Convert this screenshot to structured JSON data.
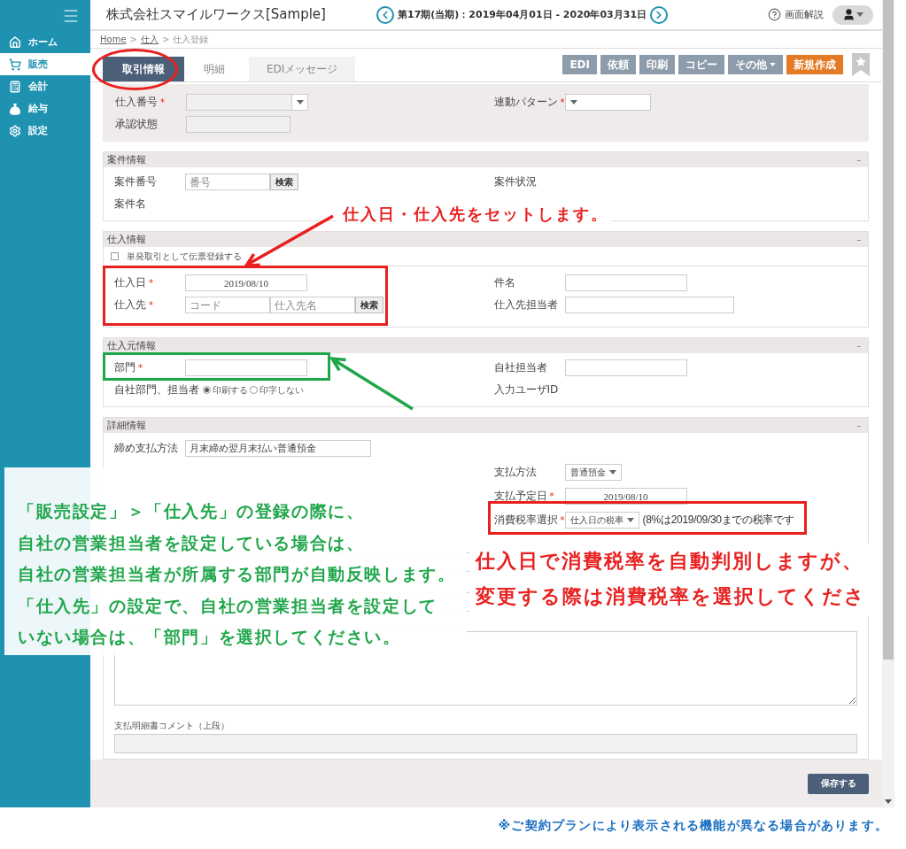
{
  "sidebar": {
    "items": [
      {
        "label": "ホーム",
        "selected": false
      },
      {
        "label": "販売",
        "selected": true
      },
      {
        "label": "会計",
        "selected": false
      },
      {
        "label": "給与",
        "selected": false
      },
      {
        "label": "設定",
        "selected": false
      }
    ]
  },
  "header": {
    "title": "株式会社スマイルワークス[Sample]",
    "period": "第17期(当期)：2019年04月01日 - 2020年03月31日",
    "help": "画面解説"
  },
  "breadcrumb": {
    "separator": ">",
    "items": [
      {
        "label": "Home",
        "link": true
      },
      {
        "label": "仕入",
        "link": true
      },
      {
        "label": "仕入登録",
        "link": false
      }
    ]
  },
  "tabs": [
    {
      "label": "取引情報",
      "selected": true
    },
    {
      "label": "明細",
      "selected": false
    },
    {
      "label": "EDIメッセージ",
      "selected": false
    }
  ],
  "actions": [
    {
      "label": "EDI",
      "disabled": true,
      "dropdown": false
    },
    {
      "label": "依頼",
      "disabled": true,
      "dropdown": false
    },
    {
      "label": "印刷",
      "disabled": true,
      "dropdown": false
    },
    {
      "label": "コピー",
      "disabled": true,
      "dropdown": false
    },
    {
      "label": "その他",
      "disabled": true,
      "dropdown": true
    },
    {
      "label": "新規作成",
      "disabled": false,
      "dropdown": false
    }
  ],
  "top_form": {
    "rows": [
      {
        "kind": "pair",
        "left": {
          "label": "仕入番号",
          "mark": "*",
          "kind": "combo",
          "disabled": true
        },
        "right": {
          "label": "連動パターン",
          "mark": "*",
          "kind": "select"
        }
      },
      {
        "kind": "pair",
        "left": {
          "label": "承認状態",
          "kind": "text",
          "disabled": true
        }
      }
    ]
  },
  "sections": [
    {
      "title": "案件情報",
      "collapse": "–",
      "rows": [
        {
          "kind": "pair",
          "left": {
            "label": "案件番号",
            "kind": "search",
            "inputs": [
              {
                "placeholder": "番号"
              }
            ],
            "button": "検索"
          },
          "right": {
            "label": "案件状況",
            "kind": "static"
          }
        },
        {
          "kind": "pair",
          "left": {
            "label": "案件名",
            "kind": "static"
          }
        }
      ]
    },
    {
      "title": "仕入情報",
      "collapse": "–",
      "rows": [
        {
          "kind": "checkbox",
          "label": "単発取引として伝票登録する",
          "checked": false
        },
        {
          "kind": "pair",
          "left": {
            "label": "仕入日",
            "mark": "*",
            "kind": "date",
            "value": "2019/08/10"
          },
          "right": {
            "label": "件名",
            "kind": "text"
          }
        },
        {
          "kind": "pair",
          "left": {
            "label": "仕入先",
            "mark": "*",
            "kind": "search",
            "inputs": [
              {
                "placeholder": "コード"
              },
              {
                "placeholder": "仕入先名"
              }
            ],
            "button": "検索"
          },
          "right": {
            "label": "仕入先担当者",
            "kind": "text"
          }
        }
      ]
    },
    {
      "title": "仕入元情報",
      "collapse": "–",
      "rows": [
        {
          "kind": "pair",
          "left": {
            "label": "部門",
            "mark": "*",
            "kind": "text"
          },
          "right": {
            "label": "自社担当者",
            "kind": "text"
          }
        },
        {
          "kind": "pair",
          "left": {
            "label": "自社部門、担当者",
            "kind": "radio",
            "options": [
              {
                "label": "印刷する",
                "selected": true
              },
              {
                "label": "印字しない",
                "selected": false
              }
            ]
          },
          "right": {
            "label": "入力ユーザID",
            "kind": "static"
          }
        }
      ]
    },
    {
      "title": "詳細情報",
      "collapse": "–",
      "rows": [
        {
          "kind": "pair",
          "left": {
            "label": "締め支払方法",
            "kind": "text",
            "value": "月末締め翌月末払い普通預金"
          }
        },
        {
          "kind": "pair",
          "right": {
            "label": "支払方法",
            "kind": "select",
            "value": "普通預金"
          }
        },
        {
          "kind": "pair",
          "right": {
            "label": "支払予定日",
            "mark": "*",
            "kind": "date",
            "value": "2019/08/10"
          }
        },
        {
          "kind": "pair",
          "right": {
            "label": "消費税率選択",
            "mark": "*",
            "kind": "select",
            "value": "仕入日の税率",
            "note": "(8%は2019/09/30までの税率です"
          }
        },
        {
          "kind": "wide_input",
          "disabled": false
        },
        {
          "kind": "wide_input",
          "disabled": false
        },
        {
          "kind": "textarea"
        },
        {
          "kind": "label",
          "text": "支払明細書コメント（上段）"
        },
        {
          "kind": "wide_input",
          "disabled": true
        }
      ]
    }
  ],
  "footer": {
    "save": "保存する"
  },
  "note": "※ご契約プランにより表示される機能が異なる場合があります。",
  "annotations": [
    {
      "kind": "circle",
      "color": "#e8201f"
    },
    {
      "kind": "frame",
      "color": "#e8201f"
    },
    {
      "kind": "text",
      "color": "#e8201f",
      "lines": [
        "仕入日・仕入先をセットします。"
      ]
    },
    {
      "kind": "arrow",
      "color": "#e8201f"
    },
    {
      "kind": "frame",
      "color": "#1fa64a"
    },
    {
      "kind": "arrow",
      "color": "#1fa64a"
    },
    {
      "kind": "panel",
      "color": "#1fa64a",
      "lines": [
        "「販売設定」＞「仕入先」の登録の際に、",
        "自社の営業担当者を設定している場合は、",
        "自社の営業担当者が所属する部門が自動反映します。",
        "「仕入先」の設定で、自社の営業担当者を設定して",
        "いない場合は、「部門」を選択してください。"
      ]
    },
    {
      "kind": "frame",
      "color": "#e8201f"
    },
    {
      "kind": "text",
      "color": "#e8201f",
      "lines": [
        "仕入日で消費税率を自動判別しますが、",
        "変更する際は消費税率を選択してくださ"
      ]
    }
  ]
}
